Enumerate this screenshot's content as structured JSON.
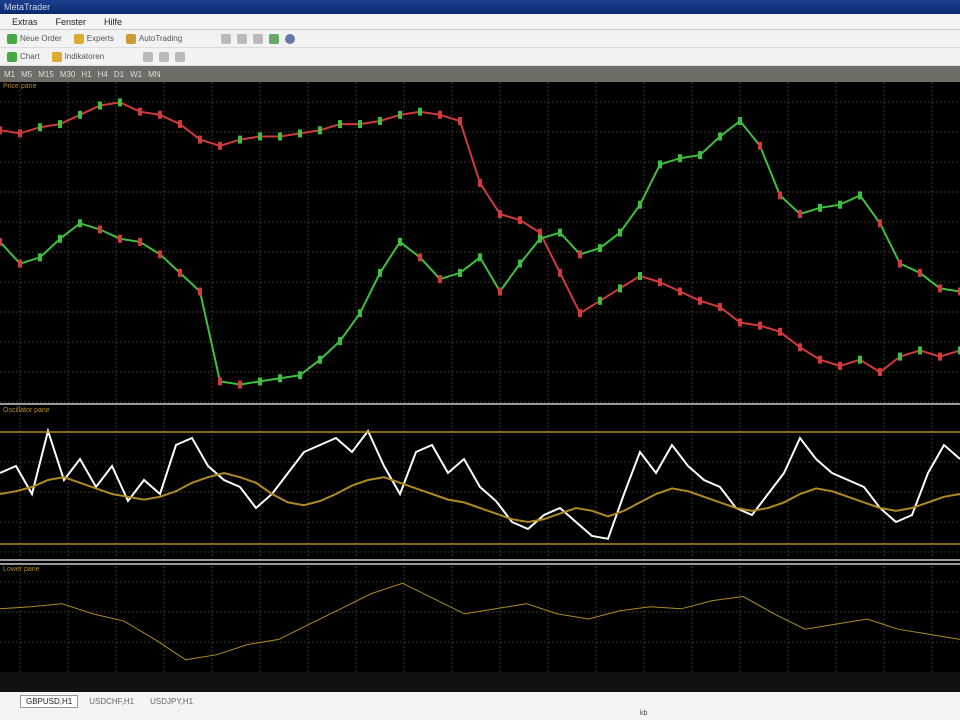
{
  "window": {
    "title": "MetaTrader"
  },
  "menu": [
    "Extras",
    "Fenster",
    "Hilfe"
  ],
  "toolbar1": [
    {
      "icon": "new-order-icon",
      "label": "Neue Order"
    },
    {
      "icon": "expert-icon",
      "label": "Experts"
    },
    {
      "icon": "autotrading-icon",
      "label": "AutoTrading"
    }
  ],
  "toolbar2": [
    {
      "icon": "chart-icon",
      "label": "Chart"
    },
    {
      "icon": "indicator-icon",
      "label": "Indikatoren"
    }
  ],
  "timeframes": [
    "M1",
    "M5",
    "M15",
    "M30",
    "H1",
    "H4",
    "D1",
    "W1",
    "MN"
  ],
  "tabs": [
    {
      "label": "GBPUSD,H1",
      "active": true
    },
    {
      "label": "USDCHF,H1",
      "active": false
    },
    {
      "label": "USDJPY,H1",
      "active": false
    }
  ],
  "status": {
    "text": "kb"
  },
  "colors": {
    "bull": "#3fbf3f",
    "bear": "#d03a3a",
    "grid": "#3a3a2a",
    "osc": "#ffffff",
    "signal": "#b08a20",
    "blue": "#4060c0"
  },
  "chart_data": [
    {
      "type": "line",
      "title": "Price pane",
      "ylim": [
        0,
        100
      ],
      "series": [
        {
          "name": "pair-1",
          "color": "#d03a3a",
          "values": [
            87,
            86,
            88,
            89,
            92,
            95,
            96,
            93,
            92,
            89,
            84,
            82,
            84,
            85,
            85,
            86,
            87,
            89,
            89,
            90,
            92,
            93,
            92,
            90,
            70,
            60,
            58,
            54,
            41,
            28,
            32,
            36,
            40,
            38,
            35,
            32,
            30,
            25,
            24,
            22,
            17,
            13,
            11,
            13,
            9,
            14,
            16,
            14,
            16
          ]
        },
        {
          "name": "pair-2",
          "color": "#3fbf3f",
          "values": [
            51,
            44,
            46,
            52,
            57,
            55,
            52,
            51,
            47,
            41,
            35,
            6,
            5,
            6,
            7,
            8,
            13,
            19,
            28,
            41,
            51,
            46,
            39,
            41,
            46,
            35,
            44,
            52,
            54,
            47,
            49,
            54,
            63,
            76,
            78,
            79,
            85,
            90,
            82,
            66,
            60,
            62,
            63,
            66,
            57,
            44,
            41,
            36,
            35
          ]
        }
      ]
    },
    {
      "type": "line",
      "title": "Oscillator pane",
      "ylim": [
        0,
        100
      ],
      "series": [
        {
          "name": "oscillator",
          "color": "#ffffff",
          "values": [
            55,
            60,
            40,
            85,
            50,
            65,
            45,
            60,
            35,
            50,
            40,
            75,
            80,
            60,
            50,
            45,
            30,
            40,
            55,
            70,
            75,
            80,
            70,
            85,
            60,
            40,
            70,
            75,
            55,
            65,
            45,
            35,
            20,
            15,
            25,
            30,
            20,
            10,
            8,
            40,
            70,
            55,
            75,
            60,
            50,
            45,
            30,
            25,
            40,
            55,
            80,
            65,
            55,
            50,
            45,
            30,
            20,
            25,
            55,
            75,
            65
          ]
        },
        {
          "name": "signal",
          "color": "#b08a20",
          "values": [
            40,
            42,
            45,
            50,
            52,
            48,
            44,
            40,
            38,
            36,
            38,
            42,
            48,
            52,
            55,
            52,
            48,
            40,
            34,
            32,
            35,
            40,
            46,
            50,
            52,
            48,
            44,
            40,
            36,
            34,
            30,
            26,
            22,
            20,
            22,
            26,
            30,
            28,
            24,
            28,
            34,
            40,
            44,
            42,
            38,
            34,
            30,
            28,
            30,
            34,
            40,
            44,
            42,
            38,
            34,
            30,
            28,
            30,
            34,
            38,
            40
          ]
        }
      ]
    },
    {
      "type": "line",
      "title": "Lower pane",
      "ylim": [
        0,
        100
      ],
      "series": [
        {
          "name": "indicator",
          "color": "#b08a20",
          "values": [
            60,
            62,
            65,
            55,
            48,
            30,
            10,
            15,
            25,
            30,
            45,
            60,
            75,
            85,
            70,
            55,
            60,
            65,
            55,
            50,
            58,
            62,
            60,
            68,
            72,
            55,
            40,
            45,
            50,
            40,
            35,
            30
          ]
        }
      ]
    }
  ]
}
